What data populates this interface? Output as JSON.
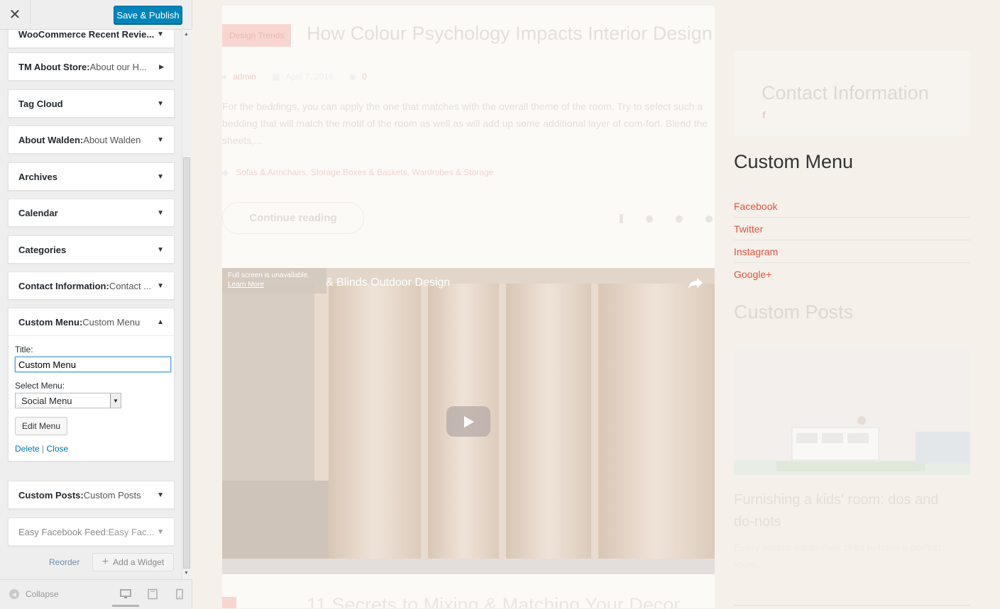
{
  "header": {
    "close_label": "✕",
    "publish_label": "Save & Publish"
  },
  "widgets": [
    {
      "title": "WooCommerce Recent Revie...",
      "subtitle": ""
    },
    {
      "title": "TM About Store:",
      "subtitle": " About our H..."
    },
    {
      "title": "Tag Cloud",
      "subtitle": ""
    },
    {
      "title": "About Walden:",
      "subtitle": " About Walden"
    },
    {
      "title": "Archives",
      "subtitle": ""
    },
    {
      "title": "Calendar",
      "subtitle": ""
    },
    {
      "title": "Categories",
      "subtitle": ""
    },
    {
      "title": "Contact Information:",
      "subtitle": " Contact ..."
    },
    {
      "title": "Custom Menu:",
      "subtitle": " Custom Menu"
    },
    {
      "title": "Custom Posts:",
      "subtitle": " Custom Posts"
    },
    {
      "title": "Easy Facebook Feed:",
      "subtitle": " Easy Fac..."
    }
  ],
  "custom_menu_form": {
    "title_label": "Title:",
    "title_value": "Custom Menu",
    "select_label": "Select Menu:",
    "select_value": "Social Menu",
    "edit_menu_label": "Edit Menu",
    "delete_label": "Delete",
    "separator": " | ",
    "close_label": "Close"
  },
  "actions": {
    "reorder_label": "Reorder",
    "add_widget_label": "Add a Widget"
  },
  "footer": {
    "collapse_label": "Collapse"
  },
  "preview": {
    "post1": {
      "category": "Design Trends",
      "title": "How Colour Psychology Impacts Interior Design",
      "author": "admin",
      "date": "April 7, 2016",
      "comments": "0",
      "excerpt": "For the beddings, you can apply the one that matches with the overall theme of the room. Try to select such a bedding that will match the motif of the room as well as will add up some additional layer of com-fort. Blend the sheets,...",
      "tags": "Sofas & Armchairs, Storage Boxes & Baskets, Wardrobes & Storage",
      "continue_label": "Continue reading"
    },
    "video": {
      "notice": "Full screen is unavailable.",
      "learn_more": "Learn More",
      "title": "& Blinds Outdoor Design"
    },
    "post2": {
      "title": "11 Secrets to Mixing & Matching Your Decor"
    },
    "sidebar": {
      "contact_title": "Contact Information",
      "menu_title": "Custom Menu",
      "menu_items": [
        "Facebook",
        "Twitter",
        "Instagram",
        "Google+"
      ],
      "posts_title": "Custom Posts",
      "post_title": "Furnishing a kids' room: dos and do-nots",
      "post_excerpt": "Every parent wants their child to have a perfect room."
    }
  }
}
